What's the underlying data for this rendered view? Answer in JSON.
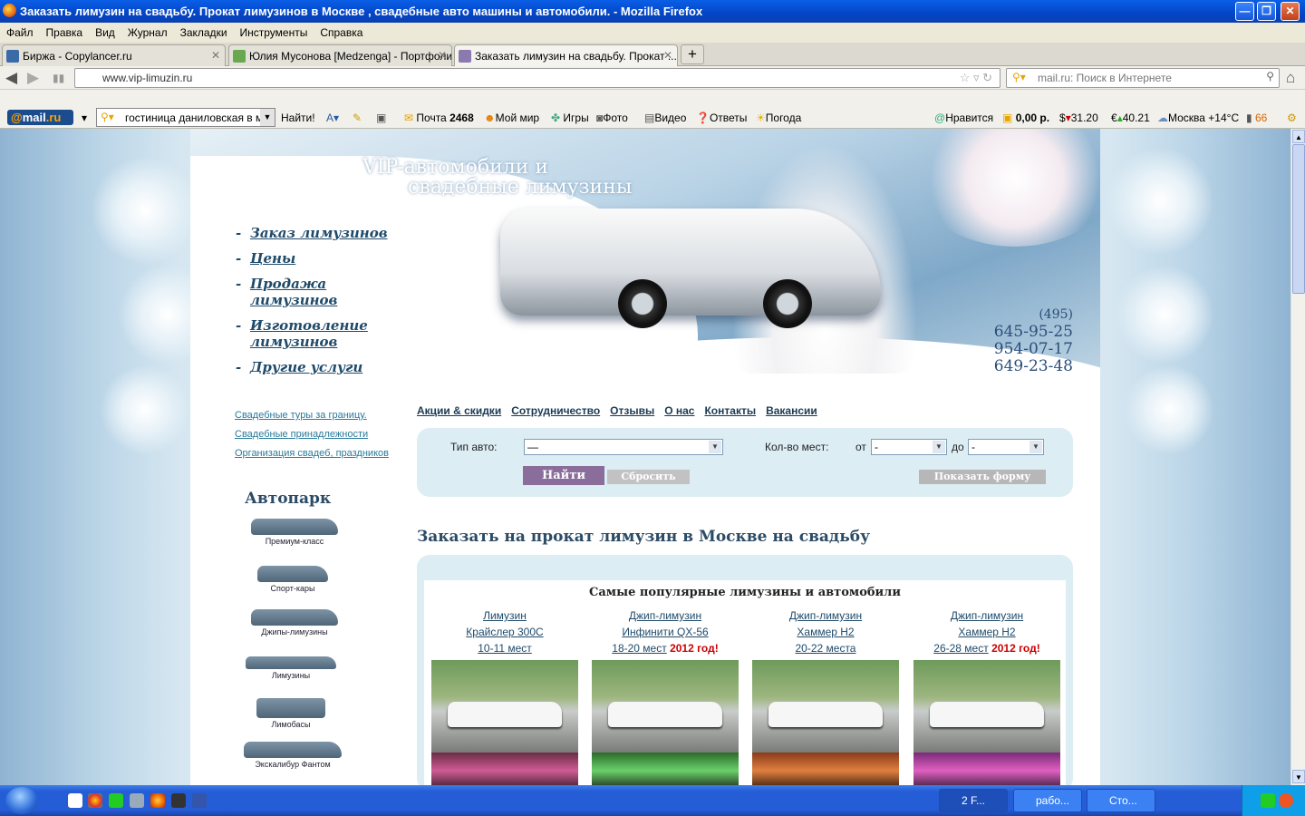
{
  "window": {
    "title": "Заказать лимузин на свадьбу. Прокат лимузинов в Москве , свадебные авто машины и автомобили. - Mozilla Firefox",
    "minimize": "—",
    "restore": "❐",
    "close": "✕"
  },
  "menu": [
    "Файл",
    "Правка",
    "Вид",
    "Журнал",
    "Закладки",
    "Инструменты",
    "Справка"
  ],
  "tabs": [
    {
      "label": "Биржа - Copylancer.ru",
      "color": "#3b6aa8"
    },
    {
      "label": "Юлия Мусонова [Medzenga] - Портфолио",
      "color": "#6aa84f"
    },
    {
      "label": "Заказать лимузин на свадьбу. Прокат ...",
      "color": "#8a7ab0"
    }
  ],
  "tab_close": "✕",
  "newtab": "+",
  "nav": {
    "url": "www.vip-limuzin.ru",
    "search_placeholder": "mail.ru: Поиск в Интернете",
    "back": "◀",
    "forward": "▶",
    "home": "⌂"
  },
  "mailbar": {
    "logo_at": "@",
    "logo_mail": "mail",
    "logo_ru": ".ru",
    "search_value": "гостиница даниловская в мо",
    "find": "Найти!",
    "mail_label": "Почта",
    "mail_count": "2468",
    "myworld": "Мой мир",
    "games": "Игры",
    "photo": "Фото",
    "video": "Видео",
    "answers": "Ответы",
    "weather": "Погода",
    "like": "Нравится",
    "money": "0,00 р.",
    "usd": "31.20",
    "eur": "40.21",
    "city": "Москва +14°C",
    "num": "66"
  },
  "site": {
    "slogan1": "VIP-автомобили и",
    "slogan2": "свадебные лимузины",
    "phone_code": "(495)",
    "phones": [
      "645-95-25",
      "954-07-17",
      "649-23-48"
    ],
    "left_nav": [
      "Заказ лимузинов",
      "Цены",
      "Продажа лимузинов",
      "Изготовление лимузинов",
      "Другие услуги"
    ],
    "side_links": [
      "Свадебные туры за границу.",
      "Свадебные принадлежности",
      "Организация свадеб, праздников"
    ],
    "park_title": "Автопарк",
    "park": [
      "Премиум-класс",
      "Спорт-кары",
      "Джипы-лимузины",
      "Лимузины",
      "Лимобасы",
      "Экскалибур Фантом"
    ],
    "top_nav": [
      "Акции & скидки",
      "Сотрудничество",
      "Отзывы",
      "О нас",
      "Контакты",
      "Вакансии"
    ],
    "filter": {
      "type_label": "Тип авто:",
      "type_value": "—",
      "seats_label": "Кол-во мест:",
      "from": "от",
      "to": "до",
      "from_value": "-",
      "to_value": "-",
      "find": "Найти",
      "reset": "Сбросить",
      "show_form": "Показать форму"
    },
    "heading": "Заказать на прокат лимузин в Москве на свадьбу",
    "popular_title": "Самые популярные лимузины и автомобили",
    "cards": [
      {
        "l1": "Лимузин",
        "l2": "Крайслер 300С",
        "l3": "10-11 мест",
        "hot": ""
      },
      {
        "l1": "Джип-лимузин",
        "l2": "Инфинити QX-56",
        "l3": "18-20 мест",
        "hot": "2012 год!"
      },
      {
        "l1": "Джип-лимузин",
        "l2": "Хаммер H2",
        "l3": "20-22 места",
        "hot": ""
      },
      {
        "l1": "Джип-лимузин",
        "l2": "Хаммер H2",
        "l3": "26-28 мест",
        "hot": "2012 год!"
      }
    ]
  },
  "taskbar": {
    "firefox": "2 F...",
    "folder": "рабо...",
    "doc": "Сто..."
  }
}
